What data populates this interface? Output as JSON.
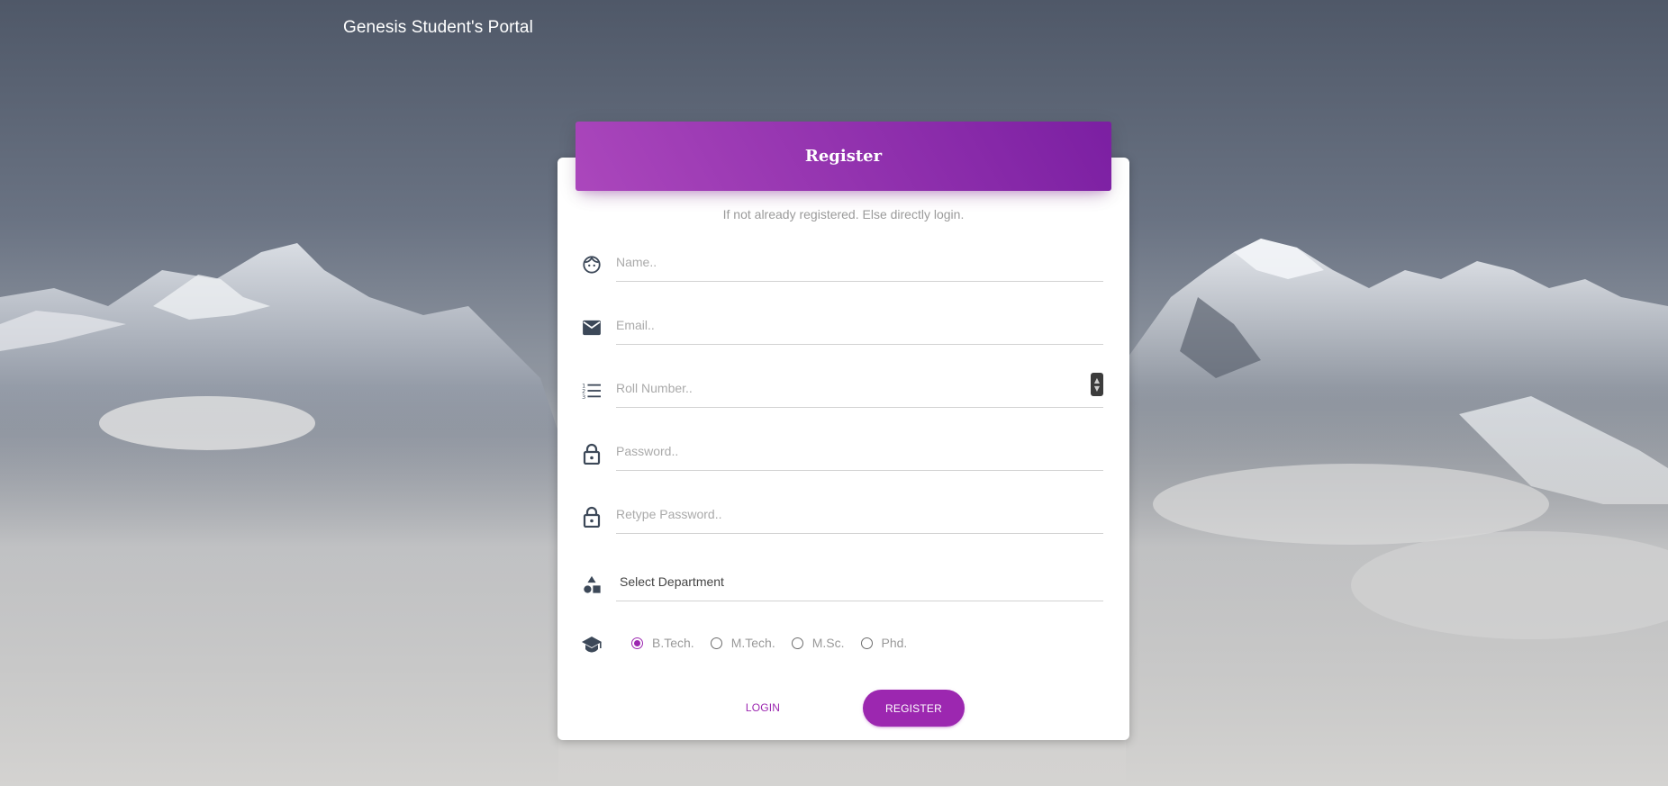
{
  "brand": {
    "title": "Genesis Student's Portal"
  },
  "card": {
    "title": "Register",
    "subtitle": "If not already registered. Else directly login."
  },
  "fields": {
    "name": {
      "placeholder": "Name..",
      "value": "",
      "icon": "face-icon"
    },
    "email": {
      "placeholder": "Email..",
      "value": "",
      "icon": "email-icon"
    },
    "roll_number": {
      "placeholder": "Roll Number..",
      "value": "",
      "icon": "list-numbered-icon"
    },
    "password": {
      "placeholder": "Password..",
      "value": "",
      "icon": "lock-icon"
    },
    "retype_password": {
      "placeholder": "Retype Password..",
      "value": "",
      "icon": "lock-icon"
    },
    "department": {
      "selected": "Select Department",
      "icon": "category-icon"
    }
  },
  "program": {
    "icon": "school-icon",
    "options": [
      "B.Tech.",
      "M.Tech.",
      "M.Sc.",
      "Phd."
    ],
    "selected": "B.Tech."
  },
  "actions": {
    "login_label": "LOGIN",
    "register_label": "REGISTER"
  },
  "colors": {
    "accent": "#9c27b0",
    "header_gradient_start": "#ab47bc",
    "header_gradient_end": "#7b1fa2",
    "icon": "#3c4858"
  }
}
